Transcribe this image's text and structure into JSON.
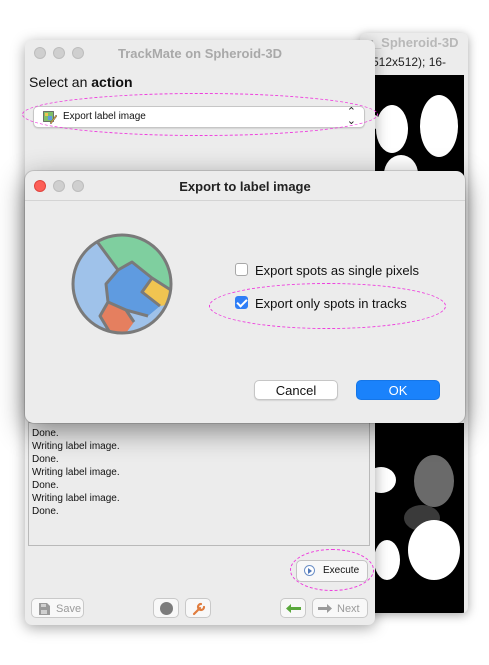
{
  "image_window": {
    "title": "g_Spheroid-3D",
    "info": "512x512); 16-"
  },
  "trackmate": {
    "title": "TrackMate on Spheroid-3D",
    "select_prefix": "Select an ",
    "select_bold": "action",
    "action_combo": {
      "value": "Export label image",
      "icon": "label-image-icon"
    },
    "log_lines": [
      "Done.",
      "Writing label image.",
      "Done.",
      "Writing label image.",
      "Done.",
      "Writing label image.",
      "Done."
    ],
    "execute_label": "Execute",
    "save_label": "Save",
    "next_label": "Next"
  },
  "dialog": {
    "title": "Export to label image",
    "options": [
      {
        "label": "Export spots as single pixels",
        "checked": false
      },
      {
        "label": "Export only spots in tracks",
        "checked": true
      }
    ],
    "cancel_label": "Cancel",
    "ok_label": "OK"
  },
  "colors": {
    "accent": "#1a82fb",
    "annotation": "#ee3bdd",
    "logo_green": "#7fcf9f",
    "logo_blue": "#5f9be0",
    "logo_light_blue": "#9fc2ea",
    "logo_yellow": "#f0c451",
    "logo_orange": "#e57f5f"
  }
}
